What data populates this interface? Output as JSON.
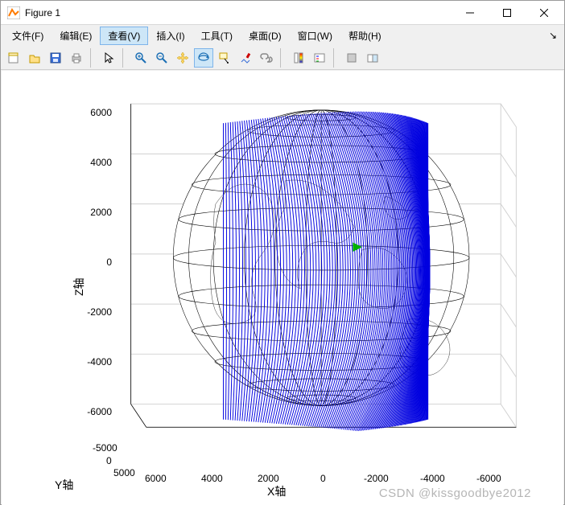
{
  "window": {
    "title": "Figure 1",
    "icon": "matlab-figure-icon"
  },
  "menubar": {
    "items": [
      {
        "label": "文件(F)"
      },
      {
        "label": "编辑(E)"
      },
      {
        "label": "查看(V)",
        "active": true
      },
      {
        "label": "插入(I)"
      },
      {
        "label": "工具(T)"
      },
      {
        "label": "桌面(D)"
      },
      {
        "label": "窗口(W)"
      },
      {
        "label": "帮助(H)"
      }
    ],
    "chevron": "⌄"
  },
  "toolbar": {
    "buttons": [
      {
        "name": "new-figure",
        "icon": "new"
      },
      {
        "name": "open",
        "icon": "open"
      },
      {
        "name": "save",
        "icon": "save"
      },
      {
        "name": "print",
        "icon": "print"
      },
      {
        "sep": true
      },
      {
        "name": "pointer",
        "icon": "pointer"
      },
      {
        "sep": true
      },
      {
        "name": "zoom-in",
        "icon": "zoom-in"
      },
      {
        "name": "zoom-out",
        "icon": "zoom-out"
      },
      {
        "name": "pan",
        "icon": "pan"
      },
      {
        "name": "rotate3d",
        "icon": "rotate3d",
        "active": true
      },
      {
        "name": "data-cursor",
        "icon": "datacursor"
      },
      {
        "name": "brush",
        "icon": "brush"
      },
      {
        "name": "link",
        "icon": "link"
      },
      {
        "sep": true
      },
      {
        "name": "colorbar",
        "icon": "colorbar"
      },
      {
        "name": "legend",
        "icon": "legend"
      },
      {
        "sep": true
      },
      {
        "name": "hide-tools",
        "icon": "hide"
      },
      {
        "name": "dock",
        "icon": "dock"
      }
    ]
  },
  "watermark": "CSDN @kissgoodbye2012",
  "chart_data": {
    "type": "3d-surface-plot",
    "title": "",
    "xlabel": "X轴",
    "ylabel": "Y轴",
    "zlabel": "Z轴",
    "x_ticks": [
      6000,
      4000,
      2000,
      0,
      -2000,
      -4000,
      -6000
    ],
    "y_ticks": [
      -5000,
      0,
      5000
    ],
    "z_ticks": [
      -6000,
      -4000,
      -2000,
      0,
      2000,
      4000,
      6000
    ],
    "xlim": [
      -7000,
      7000
    ],
    "ylim": [
      -5000,
      5000
    ],
    "zlim": [
      -7000,
      7000
    ],
    "globe": {
      "radius": 6371,
      "wireframe": "black latitude/longitude grid",
      "coastlines": true
    },
    "orbit_band": {
      "color": "#0000e0",
      "description": "dense vertical blue orbit/track lines forming an arc band roughly along a great circle",
      "approx_longitude_center_deg": 60,
      "extent_z": [
        -6371,
        6371
      ]
    },
    "marker": {
      "color": "#00b000",
      "position_xyz_approx": [
        -1000,
        1000,
        800
      ],
      "shape": "small triangle"
    }
  }
}
